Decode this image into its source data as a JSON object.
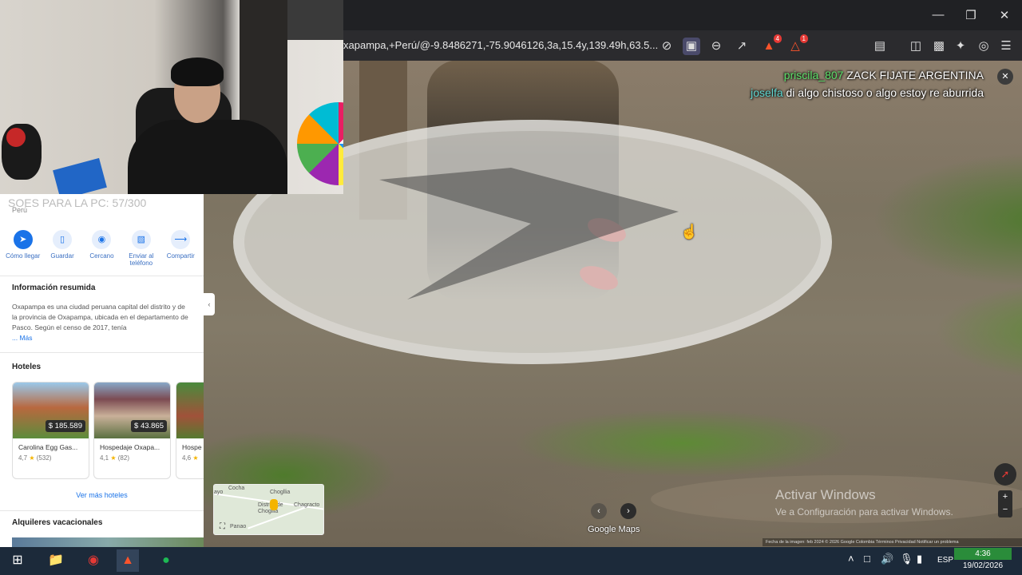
{
  "browser": {
    "url": "xapampa,+Perú/@-9.8486271,-75.9046126,3a,15.4y,139.49h,63.5...",
    "brave_badge": "4",
    "alert_badge": "1"
  },
  "chat": {
    "messages": [
      {
        "user": "priscila_807",
        "text": "ZACK FIJATE ARGENTINA"
      },
      {
        "user": "joselfa",
        "text": "di algo chistoso o algo estoy re aburrida"
      }
    ]
  },
  "panel": {
    "title": "SOES PARA LA PC: 57/300",
    "subtitle": "Perú",
    "actions": [
      {
        "label": "Cómo llegar"
      },
      {
        "label": "Guardar"
      },
      {
        "label": "Cercano"
      },
      {
        "label": "Enviar al teléfono"
      },
      {
        "label": "Compartir"
      }
    ],
    "summary_title": "Información resumida",
    "summary_text": "Oxapampa es una ciudad peruana capital del distrito y de la provincia de Oxapampa, ubicada en el departamento de Pasco. Según el censo de 2017, tenía",
    "summary_more": "... Más",
    "hotels_title": "Hoteles",
    "hotels": [
      {
        "name": "Carolina Egg Gas...",
        "price": "$ 185.589",
        "rating": "4,7",
        "reviews": "(532)"
      },
      {
        "name": "Hospedaje Oxapa...",
        "price": "$ 43.865",
        "rating": "4,1",
        "reviews": "(82)"
      },
      {
        "name": "Hospe",
        "price": "",
        "rating": "4,6",
        "reviews": ""
      }
    ],
    "see_more": "Ver más hoteles",
    "rentals_title": "Alquileres vacacionales"
  },
  "minimap": {
    "labels": [
      "Cocha",
      "Chogllia",
      "Chagracto",
      "Distrito de Chogllia",
      "Panao",
      "ayo"
    ]
  },
  "streetview": {
    "branding": "Google Maps",
    "footer": "Fecha de la imagen: feb 2024   © 2026 Google   Colombia   Términos   Privacidad   Notificar un problema"
  },
  "watermark": {
    "line1": "Activar Windows",
    "line2": "Ve a Configuración para activar Windows."
  },
  "taskbar": {
    "lang": "ESP",
    "time": "4:36",
    "date": "19/02/2026"
  }
}
